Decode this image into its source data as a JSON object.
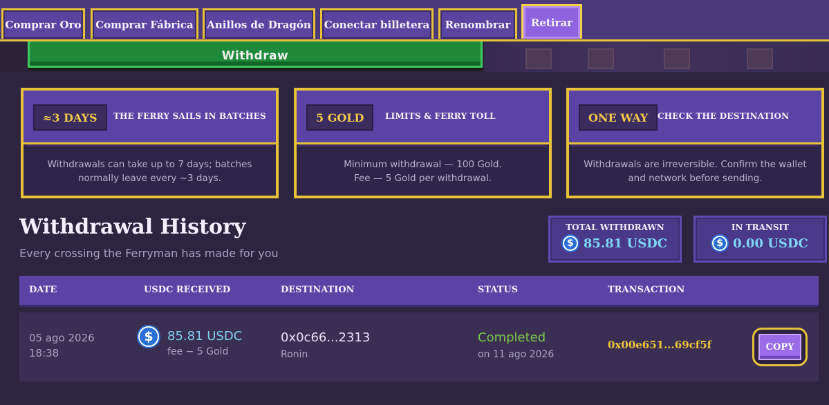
{
  "tabs": [
    {
      "label": "Comprar Oro",
      "active": false
    },
    {
      "label": "Comprar Fábrica",
      "active": false
    },
    {
      "label": "Anillos de Dragón",
      "active": false
    },
    {
      "label": "Conectar billetera",
      "active": false
    },
    {
      "label": "Renombrar",
      "active": false
    },
    {
      "label": "Retirar",
      "active": true
    }
  ],
  "banner": {
    "label": "Withdraw"
  },
  "cards": [
    {
      "pill": "≈3 DAYS",
      "title": "THE FERRY SAILS IN BATCHES",
      "body_lines": [
        "Withdrawals can take up to 7 days; batches",
        "normally leave every ~3 days."
      ]
    },
    {
      "pill": "5 GOLD",
      "title": "LIMITS & FERRY TOLL",
      "body_lines": [
        "Minimum withdrawal — 100 Gold.",
        "Fee — 5 Gold per withdrawal."
      ]
    },
    {
      "pill": "ONE WAY",
      "title": "CHECK THE DESTINATION",
      "body_lines": [
        "Withdrawals are irreversible. Confirm the wallet",
        "and network before sending."
      ]
    }
  ],
  "history": {
    "title": "Withdrawal History",
    "subtitle": "Every crossing the Ferryman has made for you"
  },
  "stats": [
    {
      "label": "TOTAL WITHDRAWN",
      "value": "85.81 USDC",
      "icon": "usdc-icon"
    },
    {
      "label": "IN TRANSIT",
      "value": "0.00 USDC",
      "icon": "usdc-icon"
    }
  ],
  "table": {
    "columns": [
      "DATE",
      "USDC RECEIVED",
      "DESTINATION",
      "STATUS",
      "TRANSACTION"
    ],
    "rows": [
      {
        "date": "05 ago 2026",
        "time": "18:38",
        "amount": "85.81 USDC",
        "fee": "fee − 5 Gold",
        "destination": "0x0c66...2313",
        "network": "Ronin",
        "status": "Completed",
        "status_date": "on 11 ago 2026",
        "tx": "0x00e651...69cf5f",
        "copy_label": "COPY"
      }
    ]
  },
  "colors": {
    "gold": "#e8c33a",
    "purple": "#5a43a4",
    "usdc": "#7fd0f0",
    "completed": "#7cc84a"
  }
}
